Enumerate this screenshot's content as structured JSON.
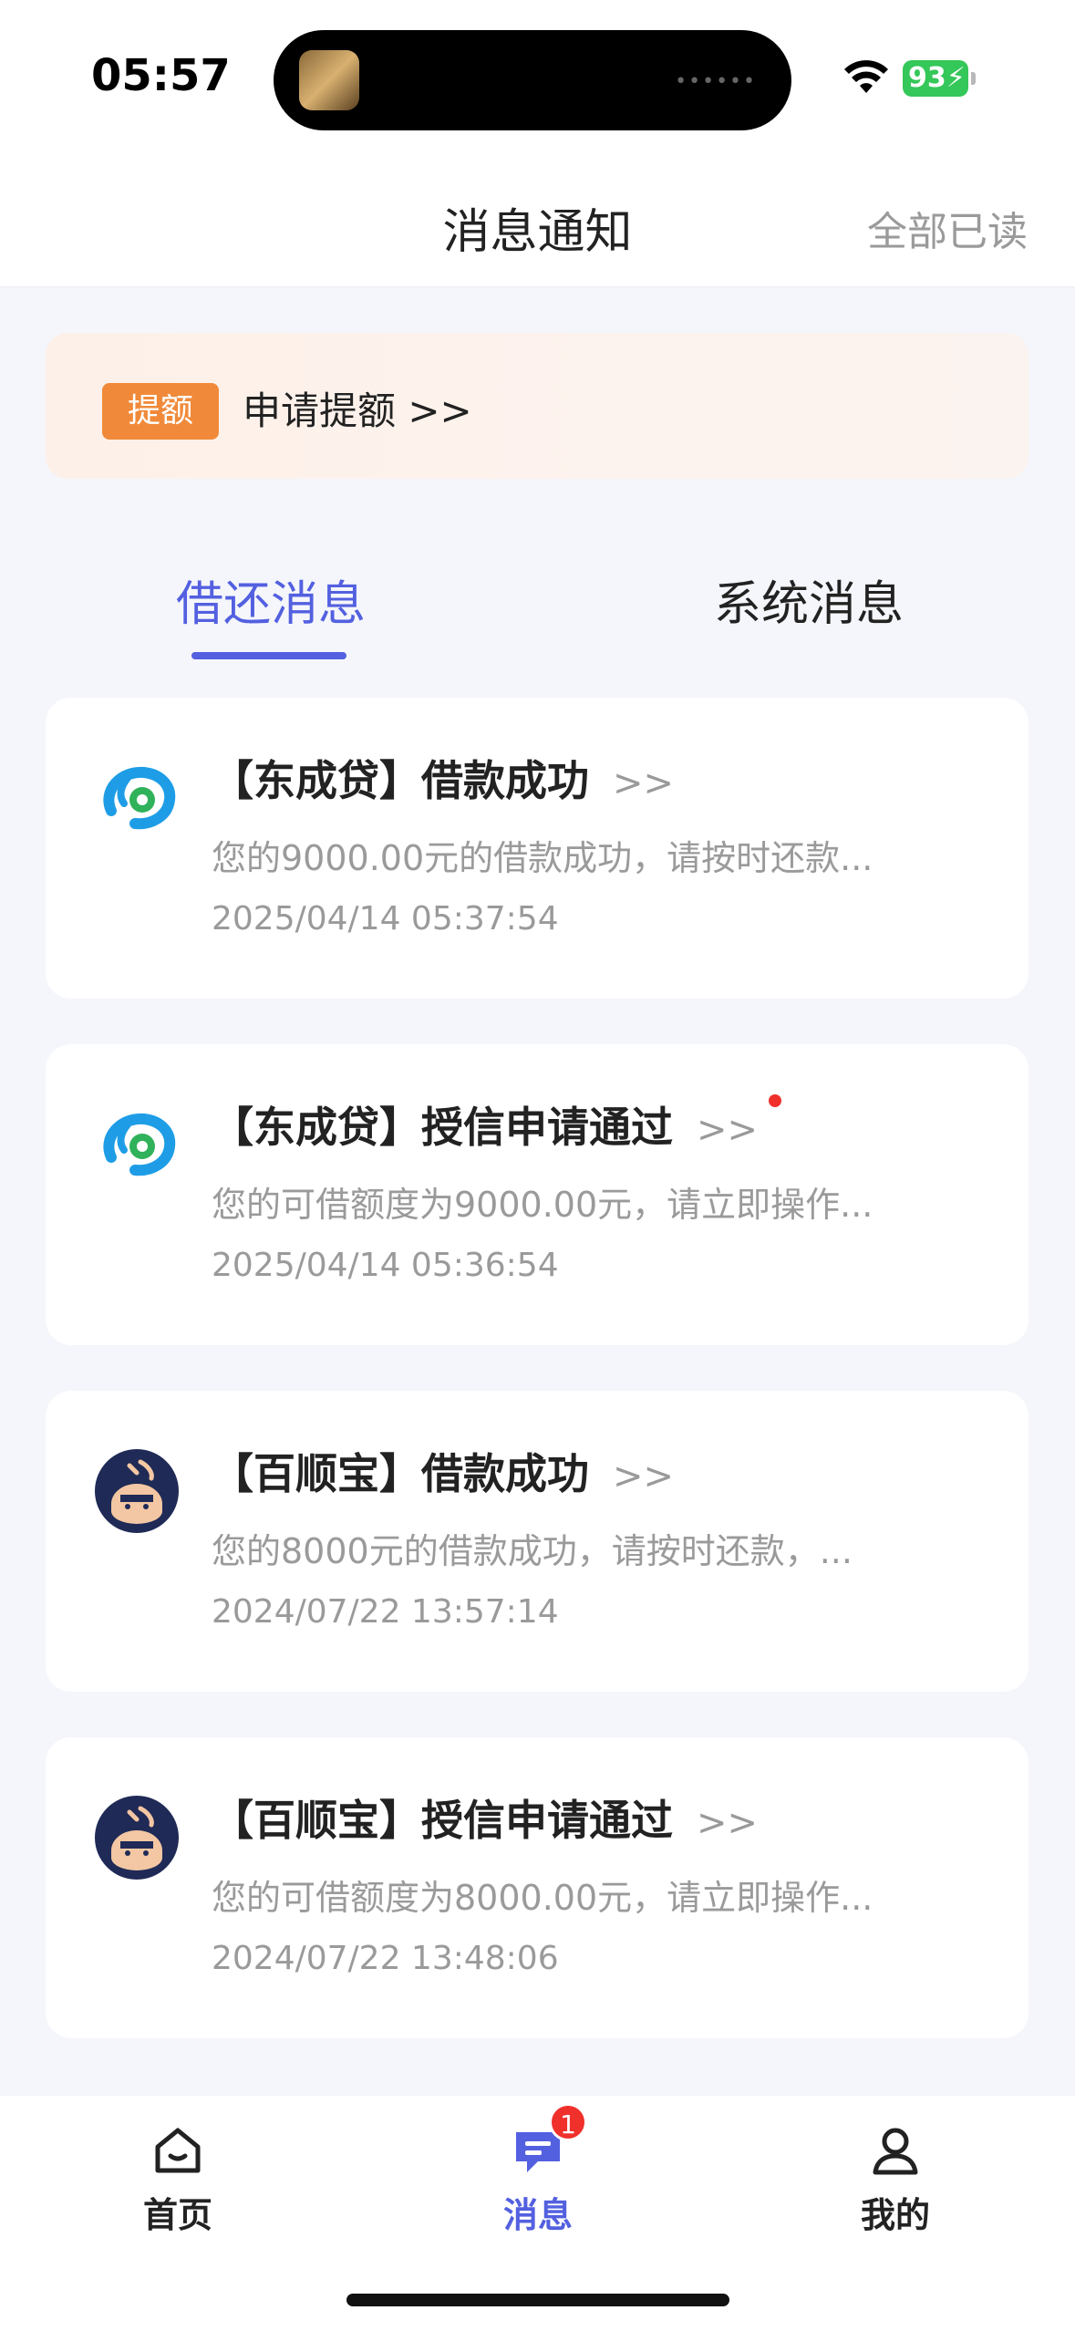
{
  "status_bar": {
    "time": "05:57",
    "battery": "93",
    "icons": [
      "wifi-icon",
      "battery-charging-icon"
    ]
  },
  "header": {
    "title": "消息通知",
    "mark_all_read": "全部已读"
  },
  "promo": {
    "badge": "提额",
    "text": "申请提额 >>"
  },
  "tabs": [
    {
      "label": "借还消息",
      "active": true
    },
    {
      "label": "系统消息",
      "active": false
    }
  ],
  "messages": [
    {
      "title": "【东成贷】借款成功",
      "arrow": ">>",
      "description": "您的9000.00元的借款成功，请按时还款...",
      "time": "2025/04/14 05:37:54",
      "logo": "dongchengdai-logo-icon",
      "unread": false
    },
    {
      "title": "【东成贷】授信申请通过",
      "arrow": ">>",
      "description": "您的可借额度为9000.00元，请立即操作...",
      "time": "2025/04/14 05:36:54",
      "logo": "dongchengdai-logo-icon",
      "unread": true
    },
    {
      "title": "【百顺宝】借款成功",
      "arrow": ">>",
      "description": "您的8000元的借款成功，请按时还款，...",
      "time": "2024/07/22 13:57:14",
      "logo": "baishunbao-logo-icon",
      "unread": false
    },
    {
      "title": "【百顺宝】授信申请通过",
      "arrow": ">>",
      "description": "您的可借额度为8000.00元，请立即操作...",
      "time": "2024/07/22 13:48:06",
      "logo": "baishunbao-logo-icon",
      "unread": false
    }
  ],
  "bottom_nav": [
    {
      "label": "首页",
      "icon": "home-icon",
      "active": false
    },
    {
      "label": "消息",
      "icon": "message-icon",
      "active": true,
      "badge": "1"
    },
    {
      "label": "我的",
      "icon": "profile-icon",
      "active": false
    }
  ],
  "colors": {
    "accent": "#5360e0",
    "promo_badge": "#f08a3a",
    "unread_dot": "#f0302b",
    "battery": "#34c759"
  }
}
